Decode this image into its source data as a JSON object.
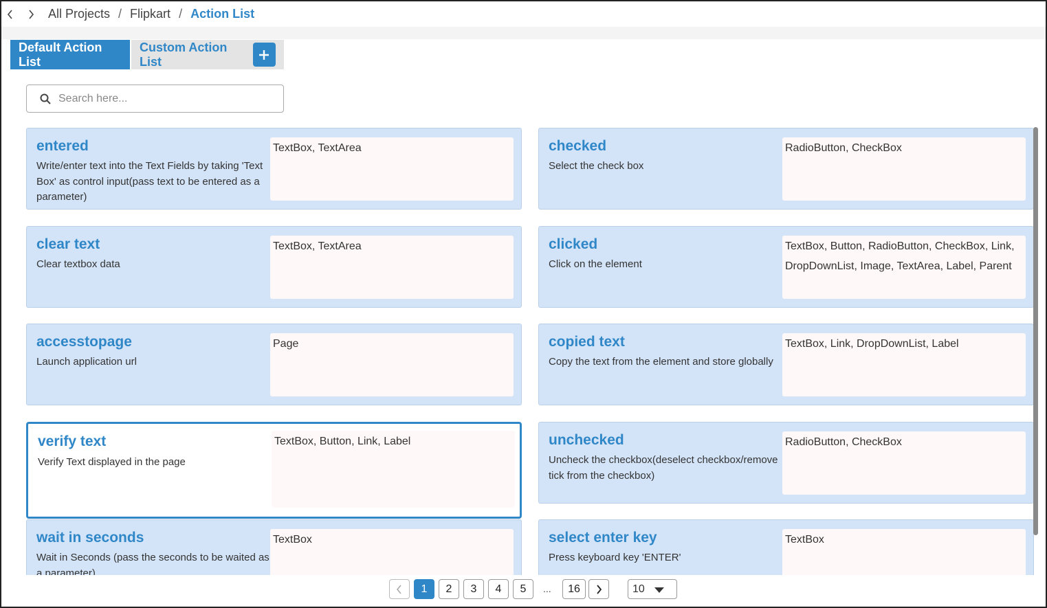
{
  "breadcrumb": {
    "items": [
      "All Projects",
      "Flipkart",
      "Action List"
    ],
    "separator": "/"
  },
  "tabs": {
    "default_label": "Default Action List",
    "custom_label": "Custom Action List"
  },
  "search": {
    "placeholder": "Search here..."
  },
  "cards": [
    {
      "title": "entered",
      "description": "Write/enter text into the Text Fields by taking 'Text Box' as control input(pass text to be entered as a parameter)",
      "controls": "TextBox,   TextArea"
    },
    {
      "title": "checked",
      "description": "Select the check box",
      "controls": "RadioButton,   CheckBox"
    },
    {
      "title": "clear text",
      "description": "Clear textbox data",
      "controls": "TextBox,   TextArea"
    },
    {
      "title": "clicked",
      "description": "Click on the element",
      "controls": "TextBox,   Button,   RadioButton,   CheckBox,   Link,   DropDownList,   Image,   TextArea,   Label,   Parent"
    },
    {
      "title": "accesstopage",
      "description": "Launch application url",
      "controls": "Page"
    },
    {
      "title": "copied text",
      "description": "Copy the text from the element and store globally",
      "controls": "TextBox,   Link,   DropDownList,   Label"
    },
    {
      "title": "verify text",
      "description": "Verify Text displayed in the page",
      "controls": "TextBox,   Button,   Link,   Label"
    },
    {
      "title": "unchecked",
      "description": "Uncheck the checkbox(deselect checkbox/remove tick from the checkbox)",
      "controls": "RadioButton,   CheckBox"
    },
    {
      "title": "wait in seconds",
      "description": "Wait in Seconds (pass the seconds to be waited as a parameter)",
      "controls": "TextBox"
    },
    {
      "title": "select enter key",
      "description": "Press keyboard key 'ENTER'",
      "controls": "TextBox"
    }
  ],
  "pagination": {
    "pages": [
      "1",
      "2",
      "3",
      "4",
      "5"
    ],
    "ellipsis": "...",
    "last_page": "16",
    "current_page": "1",
    "page_size": "10"
  },
  "colors": {
    "accent": "#2f87c8",
    "card_bg": "#d4e4f8",
    "controls_bg": "#fff8f8"
  },
  "icons": [
    "chevron-left-icon",
    "chevron-right-icon",
    "plus-icon",
    "search-icon",
    "caret-down-icon"
  ]
}
